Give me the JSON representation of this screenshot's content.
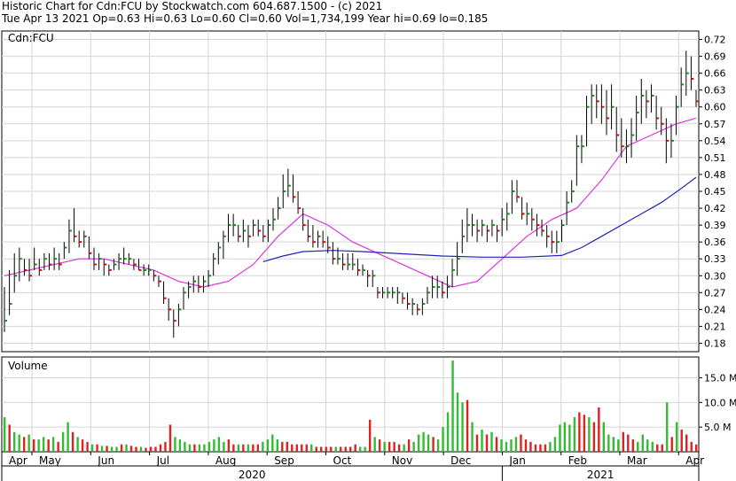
{
  "header": {
    "line1": "Historic Chart for Cdn:FCU by Stockwatch.com 604.687.1500 - (c) 2021",
    "line2": "Tue Apr 13 2021  Op=0.63  Hi=0.63  Lo=0.60  Cl=0.60  Vol=1,734,199  Year hi=0.69  lo=0.185"
  },
  "colors": {
    "up": "#1a8a1a",
    "down": "#cc1111",
    "volume_up": "#33bb33",
    "volume_down": "#dd2222",
    "ma_short": "#dd33dd",
    "ma_long": "#2222bb",
    "grid": "#d4d4d4"
  },
  "chart_data": [
    {
      "type": "bar",
      "title": "Cdn:FCU",
      "ylim": [
        0.165,
        0.735
      ],
      "yticks": [
        "0.72",
        "0.69",
        "0.66",
        "0.63",
        "0.60",
        "0.57",
        "0.54",
        "0.51",
        "0.48",
        "0.45",
        "0.42",
        "0.39",
        "0.36",
        "0.33",
        "0.30",
        "0.27",
        "0.24",
        "0.21",
        "0.18"
      ],
      "grid": true,
      "series": [
        {
          "kind": "ohlc",
          "values": [
            [
              0.28,
              0.2,
              0.22
            ],
            [
              0.31,
              0.23,
              0.25
            ],
            [
              0.34,
              0.27,
              0.3
            ],
            [
              0.35,
              0.29,
              0.33
            ],
            [
              0.33,
              0.3,
              0.31
            ],
            [
              0.33,
              0.29,
              0.3
            ],
            [
              0.35,
              0.31,
              0.32
            ],
            [
              0.33,
              0.3,
              0.31
            ],
            [
              0.34,
              0.31,
              0.33
            ],
            [
              0.34,
              0.31,
              0.32
            ],
            [
              0.35,
              0.31,
              0.33
            ],
            [
              0.34,
              0.31,
              0.32
            ],
            [
              0.36,
              0.33,
              0.35
            ],
            [
              0.4,
              0.34,
              0.38
            ],
            [
              0.42,
              0.36,
              0.37
            ],
            [
              0.38,
              0.35,
              0.36
            ],
            [
              0.38,
              0.35,
              0.37
            ],
            [
              0.37,
              0.33,
              0.34
            ],
            [
              0.35,
              0.31,
              0.32
            ],
            [
              0.34,
              0.31,
              0.33
            ],
            [
              0.33,
              0.3,
              0.32
            ],
            [
              0.32,
              0.3,
              0.31
            ],
            [
              0.33,
              0.31,
              0.32
            ],
            [
              0.34,
              0.31,
              0.33
            ],
            [
              0.35,
              0.32,
              0.33
            ],
            [
              0.34,
              0.32,
              0.33
            ],
            [
              0.33,
              0.31,
              0.32
            ],
            [
              0.33,
              0.31,
              0.31
            ],
            [
              0.32,
              0.3,
              0.31
            ],
            [
              0.32,
              0.3,
              0.31
            ],
            [
              0.31,
              0.29,
              0.3
            ],
            [
              0.3,
              0.28,
              0.29
            ],
            [
              0.29,
              0.25,
              0.26
            ],
            [
              0.26,
              0.22,
              0.24
            ],
            [
              0.24,
              0.19,
              0.22
            ],
            [
              0.25,
              0.21,
              0.24
            ],
            [
              0.28,
              0.24,
              0.27
            ],
            [
              0.29,
              0.26,
              0.28
            ],
            [
              0.3,
              0.27,
              0.29
            ],
            [
              0.3,
              0.27,
              0.28
            ],
            [
              0.3,
              0.27,
              0.29
            ],
            [
              0.31,
              0.28,
              0.3
            ],
            [
              0.34,
              0.3,
              0.33
            ],
            [
              0.36,
              0.32,
              0.35
            ],
            [
              0.38,
              0.33,
              0.37
            ],
            [
              0.41,
              0.36,
              0.39
            ],
            [
              0.41,
              0.37,
              0.39
            ],
            [
              0.39,
              0.36,
              0.37
            ],
            [
              0.4,
              0.36,
              0.38
            ],
            [
              0.39,
              0.35,
              0.37
            ],
            [
              0.4,
              0.37,
              0.39
            ],
            [
              0.4,
              0.37,
              0.38
            ],
            [
              0.39,
              0.36,
              0.37
            ],
            [
              0.4,
              0.36,
              0.39
            ],
            [
              0.42,
              0.38,
              0.4
            ],
            [
              0.44,
              0.4,
              0.42
            ],
            [
              0.48,
              0.42,
              0.45
            ],
            [
              0.49,
              0.44,
              0.46
            ],
            [
              0.48,
              0.43,
              0.44
            ],
            [
              0.45,
              0.41,
              0.42
            ],
            [
              0.42,
              0.38,
              0.39
            ],
            [
              0.4,
              0.36,
              0.37
            ],
            [
              0.39,
              0.35,
              0.36
            ],
            [
              0.38,
              0.35,
              0.37
            ],
            [
              0.38,
              0.35,
              0.36
            ],
            [
              0.37,
              0.34,
              0.35
            ],
            [
              0.36,
              0.32,
              0.33
            ],
            [
              0.35,
              0.32,
              0.33
            ],
            [
              0.34,
              0.31,
              0.32
            ],
            [
              0.34,
              0.31,
              0.32
            ],
            [
              0.34,
              0.31,
              0.32
            ],
            [
              0.33,
              0.3,
              0.31
            ],
            [
              0.32,
              0.3,
              0.31
            ],
            [
              0.31,
              0.28,
              0.3
            ],
            [
              0.31,
              0.28,
              0.3
            ],
            [
              0.28,
              0.26,
              0.27
            ],
            [
              0.28,
              0.26,
              0.27
            ],
            [
              0.28,
              0.26,
              0.27
            ],
            [
              0.28,
              0.26,
              0.27
            ],
            [
              0.28,
              0.25,
              0.27
            ],
            [
              0.27,
              0.25,
              0.26
            ],
            [
              0.27,
              0.24,
              0.25
            ],
            [
              0.26,
              0.23,
              0.25
            ],
            [
              0.25,
              0.23,
              0.24
            ],
            [
              0.26,
              0.23,
              0.25
            ],
            [
              0.28,
              0.25,
              0.27
            ],
            [
              0.3,
              0.26,
              0.28
            ],
            [
              0.3,
              0.26,
              0.28
            ],
            [
              0.29,
              0.26,
              0.27
            ],
            [
              0.3,
              0.26,
              0.28
            ],
            [
              0.33,
              0.28,
              0.31
            ],
            [
              0.36,
              0.3,
              0.33
            ],
            [
              0.4,
              0.34,
              0.37
            ],
            [
              0.42,
              0.36,
              0.39
            ],
            [
              0.41,
              0.37,
              0.39
            ],
            [
              0.4,
              0.36,
              0.38
            ],
            [
              0.4,
              0.37,
              0.39
            ],
            [
              0.39,
              0.36,
              0.38
            ],
            [
              0.4,
              0.37,
              0.39
            ],
            [
              0.39,
              0.36,
              0.38
            ],
            [
              0.42,
              0.37,
              0.4
            ],
            [
              0.43,
              0.38,
              0.41
            ],
            [
              0.47,
              0.41,
              0.45
            ],
            [
              0.47,
              0.43,
              0.44
            ],
            [
              0.44,
              0.4,
              0.41
            ],
            [
              0.43,
              0.39,
              0.41
            ],
            [
              0.42,
              0.38,
              0.4
            ],
            [
              0.41,
              0.37,
              0.39
            ],
            [
              0.4,
              0.37,
              0.38
            ],
            [
              0.39,
              0.35,
              0.37
            ],
            [
              0.38,
              0.34,
              0.36
            ],
            [
              0.38,
              0.34,
              0.36
            ],
            [
              0.4,
              0.36,
              0.39
            ],
            [
              0.45,
              0.39,
              0.43
            ],
            [
              0.47,
              0.43,
              0.45
            ],
            [
              0.55,
              0.46,
              0.53
            ],
            [
              0.55,
              0.5,
              0.53
            ],
            [
              0.62,
              0.53,
              0.6
            ],
            [
              0.64,
              0.57,
              0.62
            ],
            [
              0.64,
              0.58,
              0.61
            ],
            [
              0.64,
              0.57,
              0.6
            ],
            [
              0.63,
              0.55,
              0.58
            ],
            [
              0.64,
              0.56,
              0.6
            ],
            [
              0.6,
              0.52,
              0.55
            ],
            [
              0.58,
              0.51,
              0.53
            ],
            [
              0.56,
              0.5,
              0.53
            ],
            [
              0.58,
              0.51,
              0.55
            ],
            [
              0.62,
              0.54,
              0.59
            ],
            [
              0.65,
              0.57,
              0.62
            ],
            [
              0.63,
              0.58,
              0.61
            ],
            [
              0.64,
              0.59,
              0.62
            ],
            [
              0.62,
              0.56,
              0.58
            ],
            [
              0.6,
              0.55,
              0.57
            ],
            [
              0.58,
              0.5,
              0.54
            ],
            [
              0.57,
              0.51,
              0.54
            ],
            [
              0.62,
              0.55,
              0.6
            ],
            [
              0.67,
              0.6,
              0.64
            ],
            [
              0.7,
              0.62,
              0.66
            ],
            [
              0.69,
              0.63,
              0.65
            ],
            [
              0.63,
              0.6,
              0.61
            ]
          ]
        },
        {
          "kind": "line",
          "color_key": "ma_short",
          "x": [
            0,
            5,
            10,
            15,
            20,
            25,
            30,
            35,
            40,
            45,
            50,
            55,
            60,
            65,
            70,
            75,
            80,
            85,
            90,
            95,
            100,
            105,
            110,
            115,
            120,
            125,
            130,
            135,
            139
          ],
          "values": [
            0.3,
            0.31,
            0.32,
            0.33,
            0.33,
            0.32,
            0.31,
            0.29,
            0.28,
            0.29,
            0.32,
            0.37,
            0.41,
            0.39,
            0.36,
            0.34,
            0.32,
            0.3,
            0.28,
            0.29,
            0.33,
            0.37,
            0.4,
            0.42,
            0.47,
            0.53,
            0.55,
            0.57,
            0.58
          ]
        },
        {
          "kind": "line",
          "color_key": "ma_long",
          "x": [
            52,
            56,
            60,
            66,
            72,
            80,
            88,
            96,
            104,
            112,
            116,
            120,
            124,
            128,
            132,
            136,
            139
          ],
          "values": [
            0.325,
            0.335,
            0.343,
            0.345,
            0.343,
            0.339,
            0.335,
            0.333,
            0.333,
            0.336,
            0.35,
            0.37,
            0.39,
            0.41,
            0.43,
            0.455,
            0.475
          ]
        }
      ]
    },
    {
      "type": "bar",
      "title": "Volume",
      "ylim": [
        0,
        18.5
      ],
      "yticks": [
        "15.0 M",
        "10.0 M",
        "5.0 M"
      ],
      "grid": true,
      "values": [
        7.0,
        5.5,
        4.0,
        3.5,
        3.0,
        3.5,
        2.5,
        2.5,
        3.0,
        2.5,
        3.0,
        2.0,
        4.0,
        6.0,
        4.0,
        3.0,
        2.5,
        2.0,
        1.5,
        1.5,
        1.2,
        1.2,
        1.0,
        1.0,
        1.5,
        1.5,
        1.2,
        1.0,
        1.0,
        0.8,
        1.0,
        1.0,
        1.5,
        2.0,
        5.5,
        3.0,
        2.5,
        2.0,
        1.5,
        1.5,
        1.5,
        1.5,
        2.0,
        2.5,
        3.0,
        2.0,
        2.5,
        1.5,
        1.5,
        1.5,
        1.5,
        1.5,
        1.5,
        2.0,
        2.5,
        3.5,
        2.5,
        2.0,
        2.0,
        1.5,
        1.5,
        1.5,
        1.5,
        1.5,
        1.0,
        1.0,
        1.0,
        1.0,
        1.0,
        1.0,
        1.0,
        1.0,
        1.5,
        1.0,
        1.0,
        6.5,
        3.0,
        2.5,
        2.0,
        2.0,
        2.0,
        1.5,
        1.5,
        2.5,
        2.0,
        3.5,
        4.0,
        3.5,
        3.0,
        2.5,
        5.0,
        8.0,
        18.5,
        12.0,
        10.0,
        10.5,
        6.0,
        3.5,
        4.5,
        3.5,
        4.0,
        3.0,
        2.5,
        2.0,
        2.5,
        3.0,
        3.5,
        2.5,
        2.0,
        1.5,
        1.5,
        1.5,
        2.0,
        3.0,
        5.5,
        6.0,
        5.5,
        7.0,
        8.0,
        7.5,
        7.0,
        6.0,
        9.0,
        6.0,
        3.5,
        3.0,
        2.5,
        4.0,
        3.5,
        2.5,
        2.0,
        3.5,
        2.5,
        2.0,
        1.5,
        1.5,
        10.0,
        3.0,
        6.0,
        4.5,
        3.5,
        2.0,
        1.5
      ],
      "up": [
        1,
        0,
        1,
        1,
        0,
        1,
        0,
        1,
        1,
        0,
        1,
        0,
        1,
        1,
        0,
        1,
        0,
        0,
        1,
        0,
        1,
        0,
        1,
        1,
        0,
        1,
        0,
        0,
        1,
        0,
        0,
        0,
        0,
        0,
        0,
        1,
        1,
        1,
        1,
        0,
        1,
        1,
        1,
        1,
        1,
        1,
        0,
        0,
        1,
        0,
        1,
        0,
        0,
        1,
        1,
        1,
        1,
        0,
        0,
        0,
        0,
        0,
        0,
        1,
        0,
        0,
        0,
        0,
        1,
        0,
        0,
        0,
        0,
        1,
        1,
        0,
        1,
        0,
        1,
        0,
        0,
        0,
        1,
        0,
        1,
        1,
        1,
        1,
        0,
        1,
        1,
        1,
        1,
        1,
        1,
        0,
        1,
        0,
        1,
        0,
        1,
        0,
        1,
        1,
        1,
        1,
        0,
        0,
        0,
        0,
        0,
        0,
        1,
        1,
        1,
        1,
        1,
        1,
        0,
        0,
        1,
        0,
        0,
        1,
        1,
        1,
        1,
        0,
        0,
        0,
        1,
        1,
        1,
        1,
        0,
        0,
        1,
        0,
        1,
        0
      ]
    }
  ],
  "x_axis": {
    "months": [
      "Apr",
      "May",
      "Jun",
      "Jul",
      "Aug",
      "Sep",
      "Oct",
      "Nov",
      "Dec",
      "Jan",
      "Feb",
      "Mar",
      "Apr"
    ],
    "years": [
      "2020",
      "2021"
    ]
  }
}
